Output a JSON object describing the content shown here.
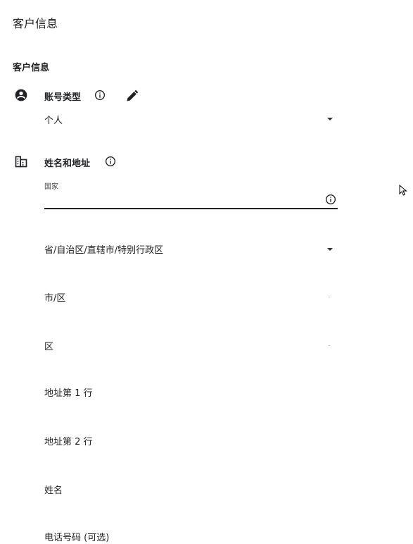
{
  "header": {
    "title": "客户信息"
  },
  "section": {
    "title": "客户信息"
  },
  "account": {
    "label": "账号类型",
    "value": "个人"
  },
  "name_address": {
    "label": "姓名和地址",
    "input_label": "国家",
    "fields": {
      "province": "省/自治区/直辖市/特别行政区",
      "city": "市/区",
      "district": "区",
      "address1": "地址第 1 行",
      "address2": "地址第 2 行",
      "name": "姓名",
      "phone": "电话号码 (可选)"
    }
  }
}
